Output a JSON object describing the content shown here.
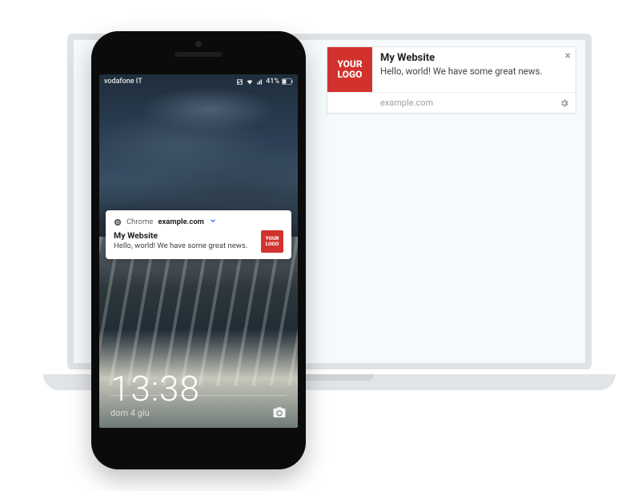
{
  "logo_text": "YOUR\nLOGO",
  "desktop_notification": {
    "title": "My Website",
    "message": "Hello, world! We have some great news.",
    "domain": "example.com"
  },
  "phone": {
    "status": {
      "carrier": "vodafone IT",
      "battery_text": "41%"
    },
    "notification": {
      "app": "Chrome",
      "site": "example.com",
      "title": "My Website",
      "message": "Hello, world! We have some great news."
    },
    "lock": {
      "time": "13:38",
      "date": "dom 4 giu"
    }
  }
}
